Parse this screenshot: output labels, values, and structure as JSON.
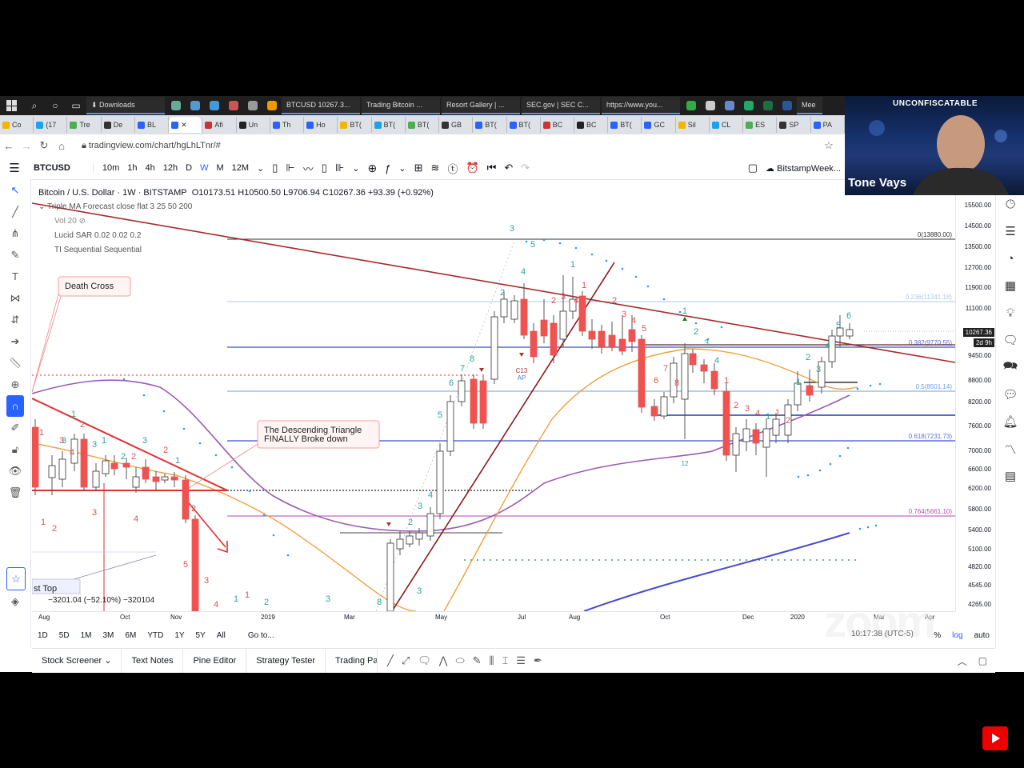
{
  "taskbar": {
    "items": [
      "Downloads",
      "BTCUSD 10267.3...",
      "Trading Bitcoin ...",
      "Resort Gallery | ...",
      "SEC.gov | SEC C...",
      "https://www.you...",
      "Mee"
    ]
  },
  "browser": {
    "tabs": [
      "Co",
      "(17",
      "Tre",
      "De",
      "BL",
      "",
      "Afi",
      "Un",
      "Th",
      "Ho",
      "BT(",
      "BT(",
      "BT(",
      "GB",
      "BT(",
      "BT(",
      "BC",
      "BC",
      "BT(",
      "GC",
      "Sil",
      "CL",
      "ES",
      "SP",
      "PA"
    ],
    "url": "tradingview.com/chart/hgLhLTnr/#"
  },
  "toolbar": {
    "symbol": "BTCUSD",
    "intervals": [
      "10m",
      "1h",
      "4h",
      "12h",
      "D",
      "W",
      "M",
      "12M"
    ],
    "layout_name": "BitstampWeek..."
  },
  "legend": {
    "title": "Bitcoin / U.S. Dollar · 1W · BITSTAMP",
    "ohlc": "O10173.51 H10500.50 L9706.94 C10267.36 +93.39 (+0.92%)",
    "indicators": [
      "Triple MA Forecast close flat 3 25 50 200",
      "Vol 20",
      "Lucid SAR 0.02 0.02 0.2",
      "TI Sequential Sequential"
    ]
  },
  "annotations": {
    "death_cross": "Death Cross",
    "triangle_line1": "The Descending Triangle",
    "triangle_line2": "FINALLY Broke down",
    "st_top": "st Top",
    "measure": "−3201.04 (−52.10%) −320104",
    "c13": "C13",
    "ap": "AP"
  },
  "fib_labels": [
    "0(13880.00)",
    "0.236(11341.18)",
    "0.382(9770.55)",
    "0.5(8501.14)",
    "0.618(7231.73)",
    "0.764(5661.10)"
  ],
  "price_axis": [
    "15500.00",
    "14500.00",
    "13500.00",
    "12700.00",
    "11900.00",
    "11100.00",
    "10267.36",
    "9450.00",
    "8800.00",
    "8200.00",
    "7600.00",
    "7000.00",
    "6600.00",
    "6200.00",
    "5800.00",
    "5400.00",
    "5100.00",
    "4820.00",
    "4545.00",
    "4265.00"
  ],
  "price_tags": {
    "last": "10267.36",
    "countdown": "2d 9h"
  },
  "time_axis": [
    "Aug",
    "Oct",
    "Nov",
    "2019",
    "Mar",
    "May",
    "Jul",
    "Aug",
    "Oct",
    "Dec",
    "2020",
    "Mar",
    "Apr"
  ],
  "ranges": [
    "1D",
    "5D",
    "1M",
    "3M",
    "6M",
    "YTD",
    "1Y",
    "5Y",
    "All",
    "Go to..."
  ],
  "axis_options": [
    "%",
    "log",
    "auto"
  ],
  "timestamp": "10:17:38 (UTC-5)",
  "bottom_tabs": [
    "Stock Screener",
    "Text Notes",
    "Pine Editor",
    "Strategy Tester",
    "Trading Pa"
  ],
  "webcam": {
    "title": "UNCONFISCATABLE",
    "name": "Tone Vays"
  },
  "watermark": "zoom",
  "colors": {
    "up": "#26a69a",
    "down": "#ef5350",
    "fib_blue": "#5b6de0",
    "trend_red": "#a52a2a"
  }
}
